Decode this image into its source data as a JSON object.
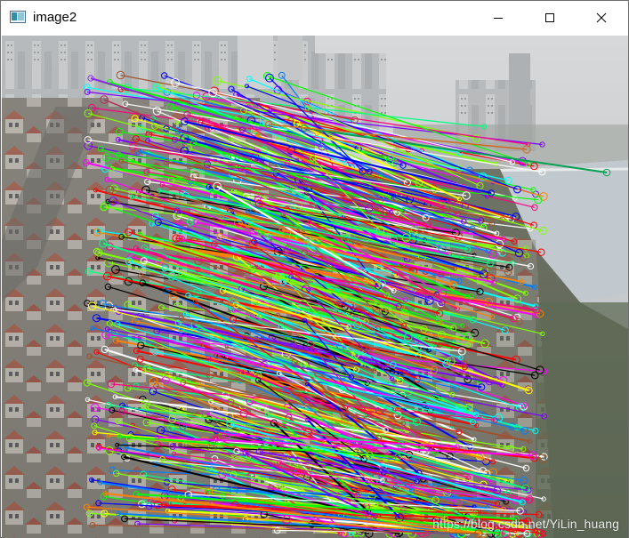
{
  "window": {
    "title": "image2",
    "app_icon": "opencv-window-icon",
    "controls": {
      "minimize": "minimize-icon",
      "maximize": "maximize-icon",
      "close": "close-icon"
    }
  },
  "image": {
    "description_icon": "feature-match-image",
    "watermark": "https://blog.csdn.net/YiLin_huang"
  },
  "colors": {
    "titlebar": "#ffffff",
    "sky": "#c9cdd0",
    "water": "#b9c2c8",
    "match_palette": [
      "#ff0000",
      "#00ff00",
      "#0000ff",
      "#ff00ff",
      "#ffff00",
      "#00ffff",
      "#ff8000",
      "#8000ff",
      "#00ff80",
      "#ff0080",
      "#80ff00",
      "#0080ff",
      "#000000",
      "#ffffff",
      "#a0522d",
      "#7fff00"
    ]
  }
}
